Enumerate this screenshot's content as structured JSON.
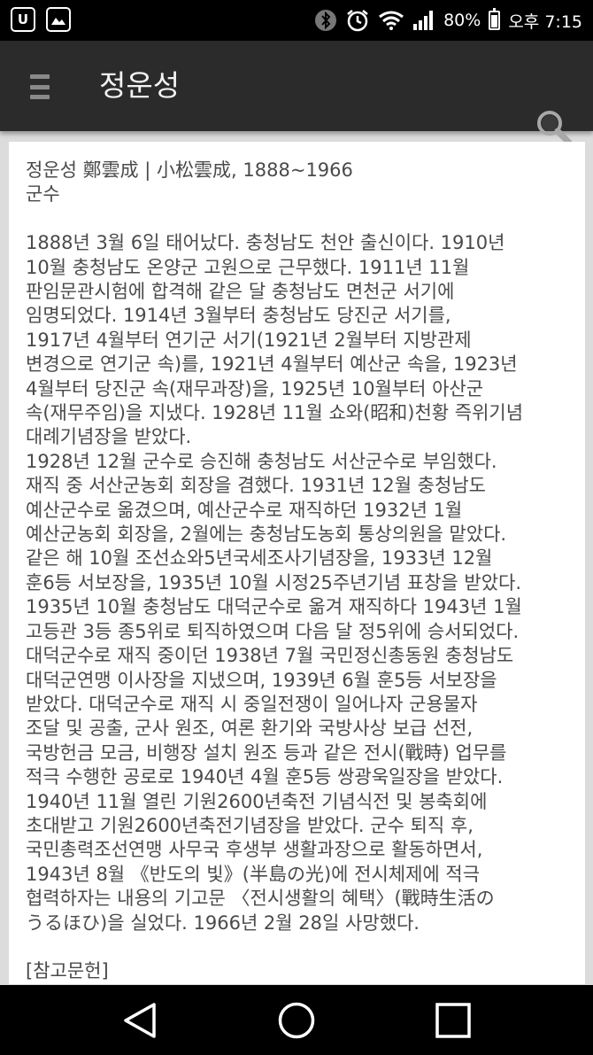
{
  "status_bar": {
    "battery": "80%",
    "time": "오후 7:15",
    "icons": [
      "u-plus-icon",
      "image-icon",
      "bluetooth-icon",
      "alarm-icon",
      "wifi-icon",
      "signal-icon",
      "battery-icon"
    ]
  },
  "app_bar": {
    "title": "정운성",
    "menu_icon": "menu-icon",
    "search_icon": "search-icon"
  },
  "article": {
    "header_line1": "정운성 鄭雲成 | 小松雲成, 1888~1966",
    "header_line2": "군수",
    "body_lines": [
      "1888년 3월 6일 태어났다. 충청남도 천안 출신이다. 1910년",
      "10월 충청남도 온양군 고원으로 근무했다. 1911년 11월",
      "판임문관시험에 합격해 같은 달 충청남도 면천군 서기에",
      "임명되었다. 1914년 3월부터 충청남도 당진군 서기를,",
      "1917년 4월부터 연기군 서기(1921년 2월부터 지방관제",
      "변경으로 연기군 속)를, 1921년 4월부터 예산군 속을, 1923년",
      "4월부터 당진군 속(재무과장)을, 1925년 10월부터 아산군",
      "속(재무주임)을 지냈다. 1928년 11월 쇼와(昭和)천황 즉위기념",
      "대례기념장을 받았다.",
      "1928년 12월 군수로 승진해 충청남도 서산군수로 부임했다.",
      "재직 중 서산군농회 회장을 겸했다. 1931년 12월 충청남도",
      "예산군수로 옮겼으며, 예산군수로 재직하던 1932년 1월",
      "예산군농회 회장을, 2월에는 충청남도농회 통상의원을 맡았다.",
      "같은 해 10월 조선쇼와5년국세조사기념장을, 1933년 12월",
      "훈6등 서보장을, 1935년 10월 시정25주년기념 표창을 받았다.",
      "1935년 10월 충청남도 대덕군수로 옮겨 재직하다 1943년 1월",
      "고등관 3등 종5위로 퇴직하였으며 다음 달 정5위에 승서되었다.",
      "대덕군수로 재직 중이던 1938년 7월 국민정신총동원 충청남도",
      "대덕군연맹 이사장을 지냈으며, 1939년 6월 훈5등 서보장을",
      "받았다. 대덕군수로 재직 시 중일전쟁이 일어나자 군용물자",
      "조달 및 공출, 군사 원조, 여론 환기와 국방사상 보급 선전,",
      "국방헌금 모금, 비행장 설치 원조 등과 같은 전시(戰時) 업무를",
      "적극 수행한 공로로 1940년 4월 훈5등 쌍광욱일장을 받았다.",
      "1940년 11월 열린 기원2600년축전 기념식전 및 봉축회에",
      "초대받고 기원2600년축전기념장을 받았다. 군수 퇴직 후,",
      "국민총력조선연맹 사무국 후생부 생활과장으로 활동하면서,",
      "1943년 8월 《반도의 빛》(半島の光)에 전시체제에 적극",
      "협력하자는 내용의 기고문 〈전시생활의 혜택〉(戰時生活の",
      "うるほひ)을 실었다. 1966년 2월 28일 사망했다."
    ],
    "references_label": "[참고문헌]"
  },
  "nav_bar": {
    "buttons": [
      "back-icon",
      "home-icon",
      "recents-icon"
    ]
  }
}
